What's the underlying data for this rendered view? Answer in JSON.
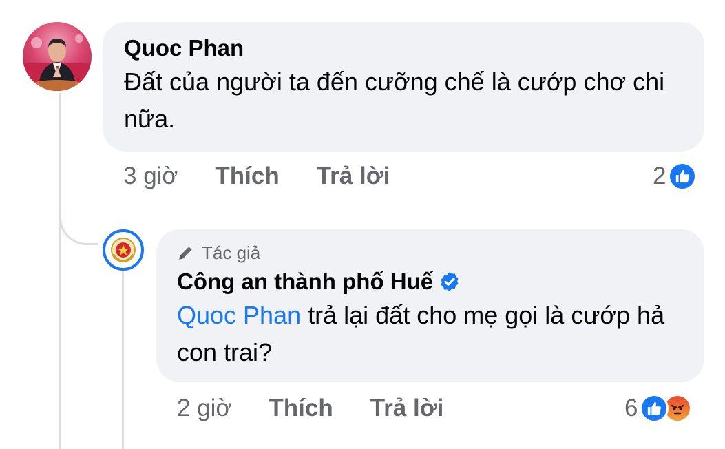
{
  "comment": {
    "author": "Quoc Phan",
    "text": "Đất của người ta đến cưỡng chế là cướp chơ chi nữa.",
    "time": "3 giờ",
    "like_label": "Thích",
    "reply_label": "Trả lời",
    "reaction_count": "2",
    "reactions": [
      "like-icon"
    ]
  },
  "reply": {
    "badge": "Tác giả",
    "author": "Công an thành phố Huế",
    "verified": true,
    "mention": "Quoc Phan",
    "text": " trả lại đất cho mẹ gọi là cướp hả con trai?",
    "time": "2 giờ",
    "like_label": "Thích",
    "reply_label": "Trả lời",
    "reaction_count": "6",
    "reactions": [
      "like-icon",
      "angry-icon"
    ]
  },
  "colors": {
    "accent": "#1877f2",
    "bubble": "#f0f2f5",
    "muted": "#65676b",
    "text": "#050505"
  }
}
